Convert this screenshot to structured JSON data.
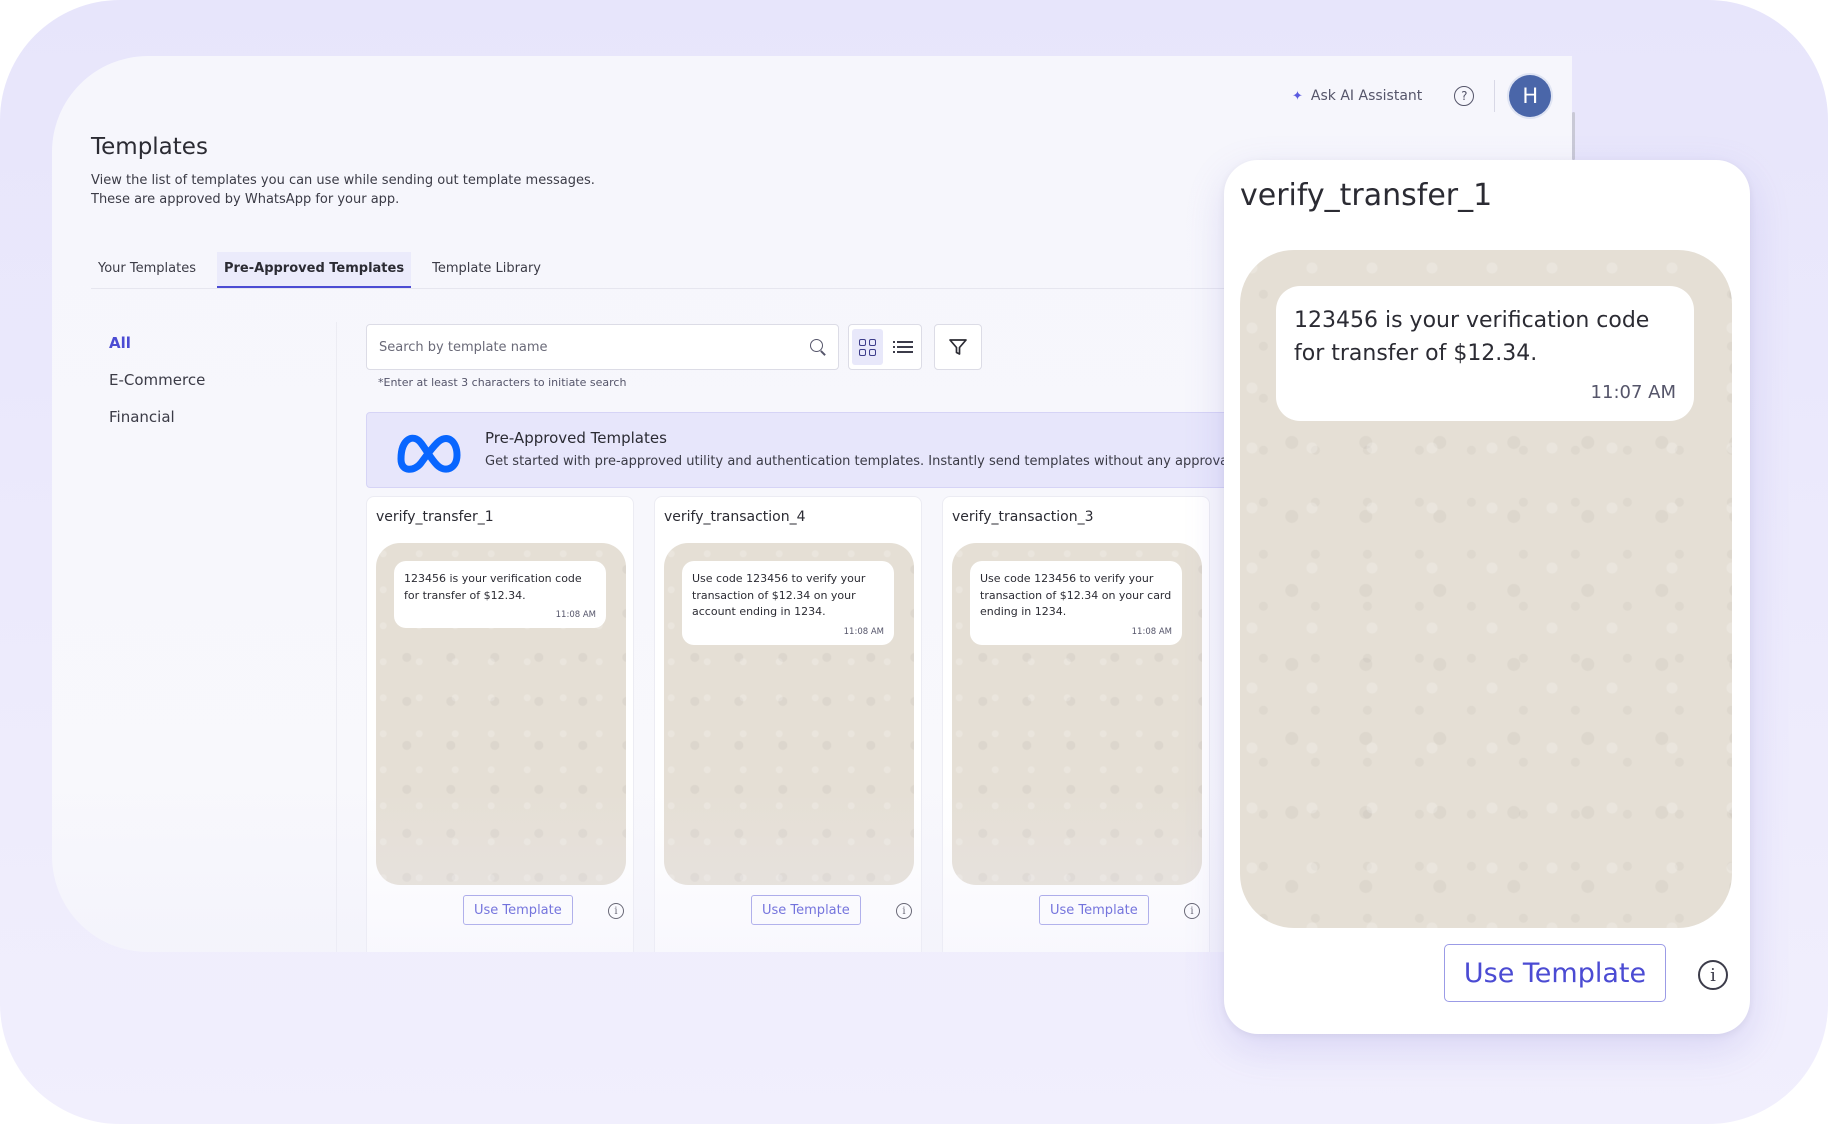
{
  "topbar": {
    "ai_assistant_label": "Ask AI Assistant",
    "help_icon": "question-circle-icon",
    "avatar_initial": "H",
    "avatar_color": "#4a66a9"
  },
  "header": {
    "title": "Templates",
    "description_line1": "View the list of templates you can use while sending out template messages.",
    "description_line2": "These are approved by WhatsApp for your app."
  },
  "tabs": [
    {
      "label": "Your Templates",
      "active": false
    },
    {
      "label": "Pre-Approved Templates",
      "active": true
    },
    {
      "label": "Template Library",
      "active": false
    }
  ],
  "categories": [
    {
      "label": "All",
      "active": true
    },
    {
      "label": "E-Commerce",
      "active": false
    },
    {
      "label": "Financial",
      "active": false
    }
  ],
  "search": {
    "placeholder": "Search by template name",
    "value": "",
    "hint": "*Enter at least 3 characters to initiate search"
  },
  "view_toggle": {
    "grid_active": true
  },
  "banner": {
    "title": "Pre-Approved Templates",
    "text": "Get started with pre-approved utility and authentication templates. Instantly send templates without any approval",
    "logo": "meta-logo"
  },
  "cards": [
    {
      "title": "verify_transfer_1",
      "message": "123456 is your verification code for transfer of $12.34.",
      "time": "11:08 AM",
      "button_label": "Use Template"
    },
    {
      "title": "verify_transaction_4",
      "message": "Use code 123456 to verify your transaction of $12.34 on your account ending in 1234.",
      "time": "11:08 AM",
      "button_label": "Use Template"
    },
    {
      "title": "verify_transaction_3",
      "message": "Use code 123456 to verify your transaction of $12.34 on your card ending in 1234.",
      "time": "11:08 AM",
      "button_label": "Use Template"
    }
  ],
  "preview": {
    "title": "verify_transfer_1",
    "message": "123456 is your verification code for transfer of $12.34.",
    "time": "11:07 AM",
    "button_label": "Use Template"
  },
  "colors": {
    "accent": "#4b4bd3",
    "chat_background": "#e5dfd5",
    "banner_background": "#e7e6fb",
    "meta_blue": "#0866ff"
  }
}
